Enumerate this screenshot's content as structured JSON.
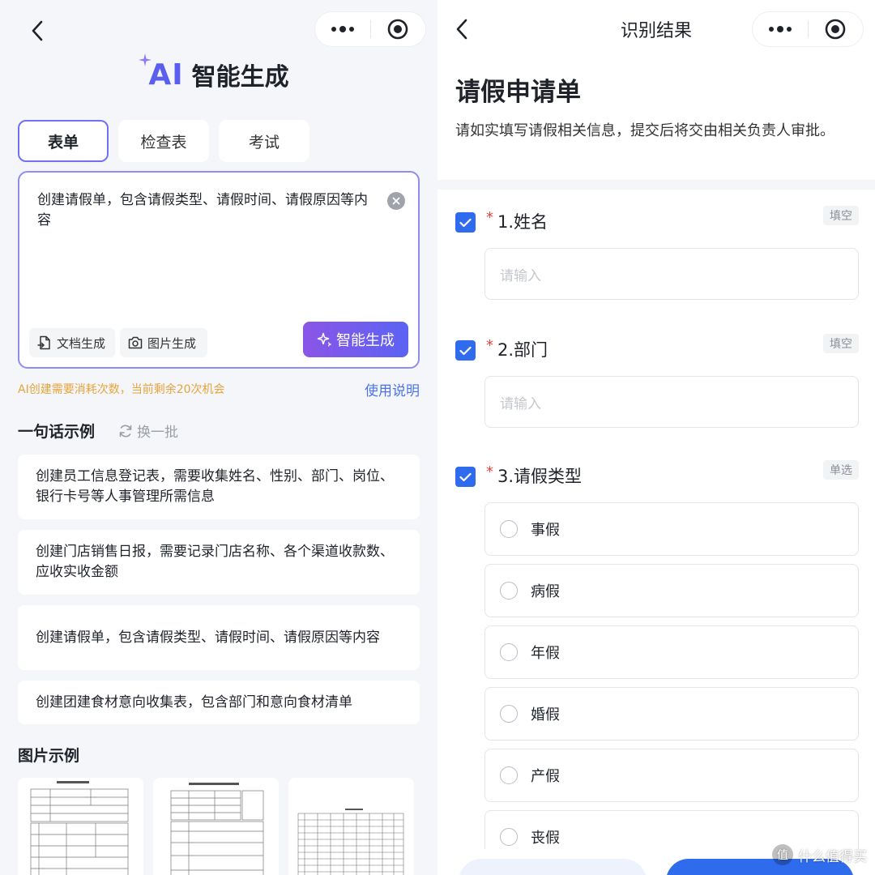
{
  "left": {
    "title": "智能生成",
    "logo_text": "AI",
    "tabs": [
      {
        "label": "表单",
        "active": true
      },
      {
        "label": "检查表",
        "active": false
      },
      {
        "label": "考试",
        "active": false
      }
    ],
    "prompt_text": "创建请假单，包含请假类型、请假时间、请假原因等内容",
    "doc_button": "文档生成",
    "image_button": "图片生成",
    "generate_button": "智能生成",
    "quota_text": "AI创建需要消耗次数，当前剩余20次机会",
    "help_link": "使用说明",
    "examples_heading": "一句话示例",
    "refresh_label": "换一批",
    "examples": [
      "创建员工信息登记表，需要收集姓名、性别、部门、岗位、银行卡号等人事管理所需信息",
      "创建门店销售日报，需要记录门店名称、各个渠道收款数、应收实收金额",
      "创建请假单，包含请假类型、请假时间、请假原因等内容",
      "创建团建食材意向收集表，包含部门和意向食材清单"
    ],
    "image_examples_heading": "图片示例"
  },
  "right": {
    "nav_title": "识别结果",
    "form_title": "请假申请单",
    "form_desc": "请如实填写请假相关信息，提交后将交由相关负责人审批。",
    "questions": [
      {
        "number": "1.姓名",
        "tag": "填空",
        "placeholder": "请输入"
      },
      {
        "number": "2.部门",
        "tag": "填空",
        "placeholder": "请输入"
      },
      {
        "number": "3.请假类型",
        "tag": "单选",
        "options": [
          "事假",
          "病假",
          "年假",
          "婚假",
          "产假",
          "丧假"
        ]
      }
    ]
  },
  "watermark": "什么值得买",
  "watermark_badge": "值",
  "colors": {
    "accent": "#5b5ff0",
    "gradient_start": "#8b55e6",
    "gradient_end": "#5b63f4",
    "link": "#4a74e8",
    "quota": "#e8a33a",
    "checkbox": "#2f6bed",
    "required": "#e8413a"
  }
}
